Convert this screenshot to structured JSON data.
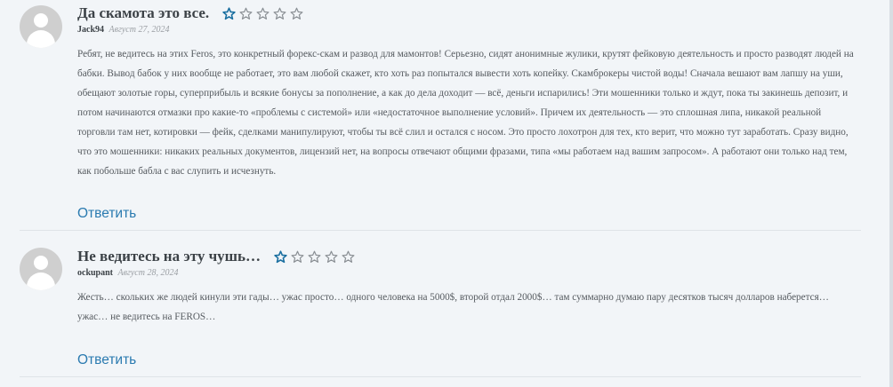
{
  "reviews": [
    {
      "title": "Да скамота это все.",
      "rating": 1,
      "max_rating": 5,
      "author": "Jack94",
      "date": "Август 27, 2024",
      "text": "Ребят, не ведитесь на этих Feros, это конкретный форекс-скам и развод для мамонтов! Серьезно, сидят анонимные жулики, крутят фейковую деятельность и просто разводят людей на бабки. Вывод бабок у них вообще не работает, это вам любой скажет, кто хоть раз попытался вывести хоть копейку. Скамброкеры чистой воды! Сначала вешают вам лапшу на уши, обещают золотые горы, суперприбыль и всякие бонусы за пополнение, а как до дела доходит — всё, деньги испарились! Эти мошенники только и ждут, пока ты закинешь депозит, и потом начинаются отмазки про какие-то «проблемы с системой» или «недостаточное выполнение условий». Причем их деятельность — это сплошная липа, никакой реальной торговли там нет, котировки — фейк, сделками манипулируют, чтобы ты всё слил и остался с носом. Это просто лохотрон для тех, кто верит, что можно тут заработать. Сразу видно, что это мошенники: никаких реальных документов, лицензий нет, на вопросы отвечают общими фразами, типа «мы работаем над вашим запросом». А работают они только над тем, как побольше бабла с вас слупить и исчезнуть.",
      "reply_label": "Ответить"
    },
    {
      "title": "Не ведитесь на эту чушь…",
      "rating": 1,
      "max_rating": 5,
      "author": "ockupant",
      "date": "Август 28, 2024",
      "text": "Жесть… скольких же людей кинули эти гады… ужас просто… одного человека на 5000$, второй отдал 2000$… там суммарно думаю пару десятков тысяч долларов наберется… ужас… не ведитесь на FEROS…",
      "reply_label": "Ответить"
    }
  ],
  "colors": {
    "star_active": "#1a6fa0",
    "star_inactive": "#8a8f94",
    "link": "#2a7ab0"
  }
}
